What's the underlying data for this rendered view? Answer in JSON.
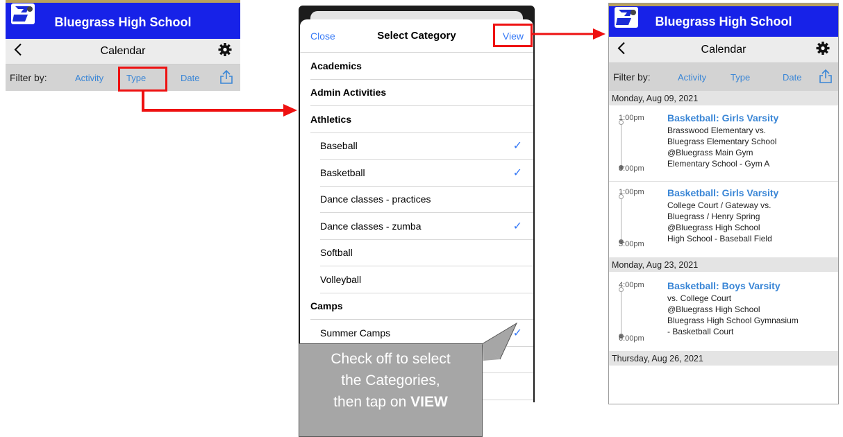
{
  "app": {
    "school_name": "Bluegrass High School",
    "nav_title": "Calendar"
  },
  "filter": {
    "label": "Filter by:",
    "activity": "Activity",
    "type": "Type",
    "date": "Date"
  },
  "sheet": {
    "close": "Close",
    "title": "Select Category",
    "view": "View",
    "rows": [
      {
        "label": "Academics",
        "header": true,
        "checked": false
      },
      {
        "label": "Admin Activities",
        "header": true,
        "checked": false
      },
      {
        "label": "Athletics",
        "header": true,
        "checked": false
      },
      {
        "label": "Baseball",
        "header": false,
        "checked": true
      },
      {
        "label": "Basketball",
        "header": false,
        "checked": true
      },
      {
        "label": "Dance classes - practices",
        "header": false,
        "checked": false
      },
      {
        "label": "Dance classes - zumba",
        "header": false,
        "checked": true
      },
      {
        "label": "Softball",
        "header": false,
        "checked": false
      },
      {
        "label": "Volleyball",
        "header": false,
        "checked": false
      },
      {
        "label": "Camps",
        "header": true,
        "checked": false
      },
      {
        "label": "Summer Camps",
        "header": false,
        "checked": true
      }
    ],
    "checkmark": "✓"
  },
  "callout": {
    "line1": "Check off to select",
    "line2": "the Categories,",
    "line3_prefix": "then tap on ",
    "line3_bold": "VIEW"
  },
  "events": {
    "date1": "Monday, Aug 09, 2021",
    "date2": "Monday, Aug 23, 2021",
    "date3": "Thursday, Aug 26, 2021",
    "items": [
      {
        "start": "1:00pm",
        "end": "3:00pm",
        "title": "Basketball: Girls Varsity",
        "lines": [
          "Brasswood Elementary vs.",
          "Bluegrass Elementary School",
          "@Bluegrass Main Gym",
          "Elementary School  - Gym A"
        ]
      },
      {
        "start": "1:00pm",
        "end": "3:00pm",
        "title": "Basketball: Girls Varsity",
        "lines": [
          "College Court / Gateway vs.",
          "Bluegrass / Henry Spring",
          "@Bluegrass High School",
          "High School  - Baseball Field"
        ]
      },
      {
        "start": "4:00pm",
        "end": "6:00pm",
        "title": "Basketball: Boys Varsity",
        "lines": [
          "vs. College Court",
          "@Bluegrass High School",
          "Bluegrass High School Gymnasium",
          "- Basketball Court"
        ]
      }
    ]
  },
  "colors": {
    "header_blue": "#1722e8",
    "link_blue": "#3478f6",
    "highlight_red": "#e11111"
  }
}
